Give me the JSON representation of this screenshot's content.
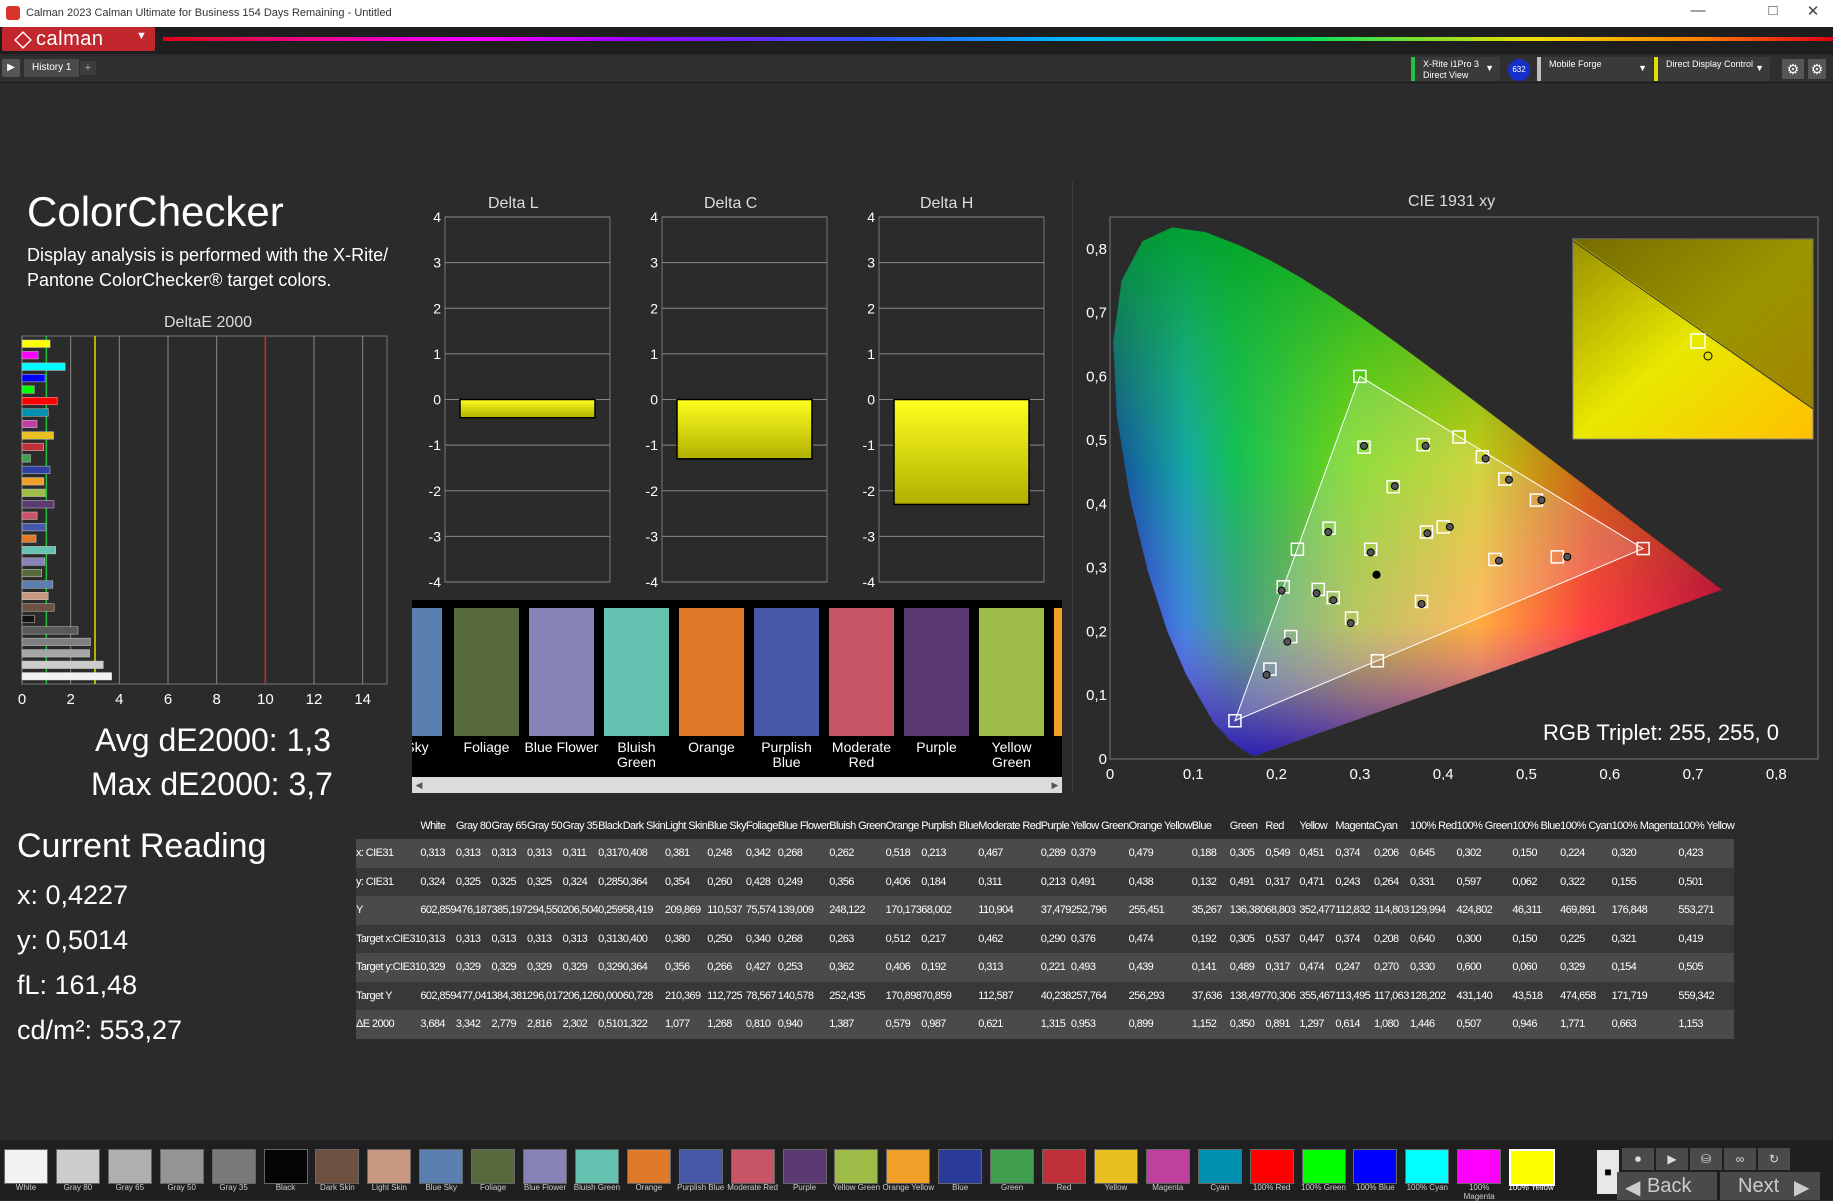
{
  "window": {
    "title": "Calman 2023 Calman Ultimate for Business 154 Days Remaining  -  Untitled",
    "minimize": "—",
    "maximize": "□",
    "close": "✕"
  },
  "logo": {
    "text": "calman",
    "menu": "▼"
  },
  "tabs": {
    "play": "▶",
    "active": "History 1",
    "add": "+"
  },
  "devices": [
    {
      "name": "X-Rite i1Pro 3\nDirect View",
      "color": "#22c040"
    },
    {
      "name": "Mobile Forge",
      "color": "#c0c0c0"
    },
    {
      "name": "Direct Display Control",
      "color": "#e0e000"
    }
  ],
  "device_badge": "632",
  "page": {
    "title": "ColorChecker",
    "description": "Display analysis is performed with the X-Rite/ Pantone ColorChecker® target colors.",
    "avg": "Avg dE2000: 1,3",
    "max": "Max dE2000: 3,7"
  },
  "current_reading": {
    "title": "Current Reading",
    "x": "x: 0,4227",
    "y": "y: 0,5014",
    "fl": "fL: 161,48",
    "cdm2": "cd/m²: 553,27"
  },
  "cie": {
    "title": "CIE 1931 xy",
    "rgb_triplet": "RGB Triplet: 255, 255, 0"
  },
  "swatch_strip": [
    {
      "label": "Sky",
      "color": "#5b7fb0"
    },
    {
      "label": "Foliage",
      "color": "#566a3e"
    },
    {
      "label": "Blue Flower",
      "color": "#8783b8"
    },
    {
      "label": "Bluish Green",
      "color": "#63c3b0"
    },
    {
      "label": "Orange",
      "color": "#e07a28"
    },
    {
      "label": "Purplish Blue",
      "color": "#4858a8"
    },
    {
      "label": "Moderate Red",
      "color": "#c85468"
    },
    {
      "label": "Purple",
      "color": "#5a3a70"
    },
    {
      "label": "Yellow Green",
      "color": "#a0bc48"
    }
  ],
  "chart_data": [
    {
      "type": "bar",
      "title": "DeltaE 2000",
      "orientation": "horizontal",
      "xlim": [
        0,
        15
      ],
      "xticks": [
        "0",
        "2",
        "4",
        "6",
        "8",
        "10",
        "12",
        "14"
      ],
      "reference_lines": [
        {
          "value": 1,
          "color": "#22c040"
        },
        {
          "value": 3,
          "color": "#e0e000"
        },
        {
          "value": 10,
          "color": "#e02020"
        }
      ],
      "categories": [
        "100% Yellow",
        "100% Magenta",
        "100% Cyan",
        "100% Blue",
        "100% Green",
        "100% Red",
        "Cyan",
        "Magenta",
        "Yellow",
        "Red",
        "Green",
        "Blue",
        "Orange Yellow",
        "Yellow Green",
        "Purple",
        "Moderate Red",
        "Purplish Blue",
        "Orange",
        "Bluish Green",
        "Blue Flower",
        "Foliage",
        "Blue Sky",
        "Light Skin",
        "Dark Skin",
        "Black",
        "Gray 35",
        "Gray 50",
        "Gray 65",
        "Gray 80",
        "White"
      ],
      "values": [
        1.153,
        0.663,
        1.771,
        0.946,
        0.507,
        1.446,
        1.08,
        0.614,
        1.297,
        0.891,
        0.35,
        1.152,
        0.899,
        0.953,
        1.315,
        0.621,
        0.987,
        0.579,
        1.387,
        0.94,
        0.81,
        1.268,
        1.077,
        1.322,
        0.51,
        2.302,
        2.816,
        2.779,
        3.342,
        3.684
      ],
      "colors": [
        "#ffff00",
        "#ff00ff",
        "#00ffff",
        "#0000ff",
        "#00ff00",
        "#ff0000",
        "#0090b0",
        "#c040a0",
        "#e8c020",
        "#c03038",
        "#40a050",
        "#3040a0",
        "#f0a028",
        "#a0bc48",
        "#5a3a70",
        "#c85468",
        "#4858a8",
        "#e07a28",
        "#63c3b0",
        "#8783b8",
        "#566a3e",
        "#5b7fb0",
        "#c89880",
        "#6e5040",
        "#111111",
        "#5a5a5a",
        "#7f7f7f",
        "#a6a6a6",
        "#cccccc",
        "#f2f2f2"
      ]
    },
    {
      "type": "bar",
      "title": "Delta L",
      "ylim": [
        -4,
        4
      ],
      "yticks": [
        "4",
        "3",
        "2",
        "1",
        "0",
        "-1",
        "-2",
        "-3",
        "-4"
      ],
      "values": [
        -0.4
      ],
      "color": "#f0f000"
    },
    {
      "type": "bar",
      "title": "Delta C",
      "ylim": [
        -4,
        4
      ],
      "yticks": [
        "4",
        "3",
        "2",
        "1",
        "0",
        "-1",
        "-2",
        "-3",
        "-4"
      ],
      "values": [
        -1.3
      ],
      "color": "#f0f000"
    },
    {
      "type": "bar",
      "title": "Delta H",
      "ylim": [
        -4,
        4
      ],
      "yticks": [
        "4",
        "3",
        "2",
        "1",
        "0",
        "-1",
        "-2",
        "-3",
        "-4"
      ],
      "values": [
        -2.3
      ],
      "color": "#f0f000"
    },
    {
      "type": "scatter",
      "title": "CIE 1931 xy",
      "xlim": [
        0,
        0.85
      ],
      "ylim": [
        0,
        0.85
      ],
      "xticks": [
        "0",
        "0,1",
        "0,2",
        "0,3",
        "0,4",
        "0,5",
        "0,6",
        "0,7",
        "0,8"
      ],
      "yticks": [
        "0,8",
        "0,7",
        "0,6",
        "0,5",
        "0,4",
        "0,3",
        "0,2",
        "0,1",
        "0"
      ],
      "gamut_triangle": [
        [
          0.64,
          0.33
        ],
        [
          0.3,
          0.6
        ],
        [
          0.15,
          0.06
        ]
      ],
      "targets": [
        [
          0.313,
          0.329
        ],
        [
          0.4,
          0.364
        ],
        [
          0.38,
          0.356
        ],
        [
          0.25,
          0.266
        ],
        [
          0.34,
          0.427
        ],
        [
          0.268,
          0.253
        ],
        [
          0.263,
          0.362
        ],
        [
          0.512,
          0.406
        ],
        [
          0.217,
          0.192
        ],
        [
          0.462,
          0.313
        ],
        [
          0.29,
          0.221
        ],
        [
          0.376,
          0.493
        ],
        [
          0.474,
          0.439
        ],
        [
          0.192,
          0.141
        ],
        [
          0.305,
          0.489
        ],
        [
          0.537,
          0.317
        ],
        [
          0.447,
          0.474
        ],
        [
          0.374,
          0.247
        ],
        [
          0.208,
          0.27
        ],
        [
          0.64,
          0.33
        ],
        [
          0.3,
          0.6
        ],
        [
          0.15,
          0.06
        ],
        [
          0.225,
          0.329
        ],
        [
          0.321,
          0.154
        ],
        [
          0.419,
          0.505
        ]
      ],
      "measured": [
        [
          0.313,
          0.324
        ],
        [
          0.408,
          0.364
        ],
        [
          0.381,
          0.354
        ],
        [
          0.248,
          0.26
        ],
        [
          0.342,
          0.428
        ],
        [
          0.268,
          0.249
        ],
        [
          0.262,
          0.356
        ],
        [
          0.518,
          0.406
        ],
        [
          0.213,
          0.184
        ],
        [
          0.467,
          0.311
        ],
        [
          0.289,
          0.213
        ],
        [
          0.379,
          0.491
        ],
        [
          0.479,
          0.438
        ],
        [
          0.188,
          0.132
        ],
        [
          0.305,
          0.491
        ],
        [
          0.549,
          0.317
        ],
        [
          0.451,
          0.471
        ],
        [
          0.374,
          0.243
        ],
        [
          0.206,
          0.264
        ],
        [
          0.32,
          0.289
        ]
      ],
      "current_reading": [
        0.4227,
        0.5014
      ]
    }
  ],
  "table": {
    "columns": [
      "",
      "White",
      "Gray 80",
      "Gray 65",
      "Gray 50",
      "Gray 35",
      "Black",
      "Dark Skin",
      "Light Skin",
      "Blue Sky",
      "Foliage",
      "Blue Flower",
      "Bluish Green",
      "Orange",
      "Purplish Blue",
      "Moderate Red",
      "Purple",
      "Yellow Green",
      "Orange Yellow",
      "Blue",
      "Green",
      "Red",
      "Yellow",
      "Magenta",
      "Cyan",
      "100% Red",
      "100% Green",
      "100% Blue",
      "100% Cyan",
      "100% Magenta",
      "100% Yellow"
    ],
    "rows": [
      [
        "x: CIE31",
        "0,313",
        "0,313",
        "0,313",
        "0,313",
        "0,311",
        "0,317",
        "0,408",
        "0,381",
        "0,248",
        "0,342",
        "0,268",
        "0,262",
        "0,518",
        "0,213",
        "0,467",
        "0,289",
        "0,379",
        "0,479",
        "0,188",
        "0,305",
        "0,549",
        "0,451",
        "0,374",
        "0,206",
        "0,645",
        "0,302",
        "0,150",
        "0,224",
        "0,320",
        "0,423"
      ],
      [
        "y: CIE31",
        "0,324",
        "0,325",
        "0,325",
        "0,325",
        "0,324",
        "0,285",
        "0,364",
        "0,354",
        "0,260",
        "0,428",
        "0,249",
        "0,356",
        "0,406",
        "0,184",
        "0,311",
        "0,213",
        "0,491",
        "0,438",
        "0,132",
        "0,491",
        "0,317",
        "0,471",
        "0,243",
        "0,264",
        "0,331",
        "0,597",
        "0,062",
        "0,322",
        "0,155",
        "0,501"
      ],
      [
        "Y",
        "602,859",
        "476,187",
        "385,197",
        "294,550",
        "206,504",
        "0,259",
        "58,419",
        "209,869",
        "110,537",
        "75,574",
        "139,009",
        "248,122",
        "170,173",
        "68,002",
        "110,904",
        "37,479",
        "252,796",
        "255,451",
        "35,267",
        "136,380",
        "68,803",
        "352,477",
        "112,832",
        "114,803",
        "129,994",
        "424,802",
        "46,311",
        "469,891",
        "176,848",
        "553,271"
      ],
      [
        "Target x:CIE31",
        "0,313",
        "0,313",
        "0,313",
        "0,313",
        "0,313",
        "0,313",
        "0,400",
        "0,380",
        "0,250",
        "0,340",
        "0,268",
        "0,263",
        "0,512",
        "0,217",
        "0,462",
        "0,290",
        "0,376",
        "0,474",
        "0,192",
        "0,305",
        "0,537",
        "0,447",
        "0,374",
        "0,208",
        "0,640",
        "0,300",
        "0,150",
        "0,225",
        "0,321",
        "0,419"
      ],
      [
        "Target y:CIE31",
        "0,329",
        "0,329",
        "0,329",
        "0,329",
        "0,329",
        "0,329",
        "0,364",
        "0,356",
        "0,266",
        "0,427",
        "0,253",
        "0,362",
        "0,406",
        "0,192",
        "0,313",
        "0,221",
        "0,493",
        "0,439",
        "0,141",
        "0,489",
        "0,317",
        "0,474",
        "0,247",
        "0,270",
        "0,330",
        "0,600",
        "0,060",
        "0,329",
        "0,154",
        "0,505"
      ],
      [
        "Target Y",
        "602,859",
        "477,041",
        "384,381",
        "296,017",
        "206,126",
        "0,000",
        "60,728",
        "210,369",
        "112,725",
        "78,567",
        "140,578",
        "252,435",
        "170,898",
        "70,859",
        "112,587",
        "40,238",
        "257,764",
        "256,293",
        "37,636",
        "138,497",
        "70,306",
        "355,467",
        "113,495",
        "117,063",
        "128,202",
        "431,140",
        "43,518",
        "474,658",
        "171,719",
        "559,342"
      ],
      [
        "ΔE 2000",
        "3,684",
        "3,342",
        "2,779",
        "2,816",
        "2,302",
        "0,510",
        "1,322",
        "1,077",
        "1,268",
        "0,810",
        "0,940",
        "1,387",
        "0,579",
        "0,987",
        "0,621",
        "1,315",
        "0,953",
        "0,899",
        "1,152",
        "0,350",
        "0,891",
        "1,297",
        "0,614",
        "1,080",
        "1,446",
        "0,507",
        "0,946",
        "1,771",
        "0,663",
        "1,153"
      ]
    ]
  },
  "bottom_swatches": [
    {
      "label": "White",
      "color": "#f2f2f2"
    },
    {
      "label": "Gray 80",
      "color": "#cccccc"
    },
    {
      "label": "Gray 65",
      "color": "#b0b0b0"
    },
    {
      "label": "Gray 50",
      "color": "#959595"
    },
    {
      "label": "Gray 35",
      "color": "#7a7a7a"
    },
    {
      "label": "Black",
      "color": "#050505"
    },
    {
      "label": "Dark Skin",
      "color": "#6e5040"
    },
    {
      "label": "Light Skin",
      "color": "#c89880"
    },
    {
      "label": "Blue Sky",
      "color": "#5b7fb0"
    },
    {
      "label": "Foliage",
      "color": "#566a3e"
    },
    {
      "label": "Blue Flower",
      "color": "#8783b8"
    },
    {
      "label": "Bluish Green",
      "color": "#63c3b0"
    },
    {
      "label": "Orange",
      "color": "#e07a28"
    },
    {
      "label": "Purplish Blue",
      "color": "#4858a8"
    },
    {
      "label": "Moderate Red",
      "color": "#c85468"
    },
    {
      "label": "Purple",
      "color": "#5a3a70"
    },
    {
      "label": "Yellow Green",
      "color": "#a0bc48"
    },
    {
      "label": "Orange Yellow",
      "color": "#f0a028"
    },
    {
      "label": "Blue",
      "color": "#2a3a9a"
    },
    {
      "label": "Green",
      "color": "#40a050"
    },
    {
      "label": "Red",
      "color": "#c03038"
    },
    {
      "label": "Yellow",
      "color": "#e8c020"
    },
    {
      "label": "Magenta",
      "color": "#c040a0"
    },
    {
      "label": "Cyan",
      "color": "#0090b0"
    },
    {
      "label": "100% Red",
      "color": "#ff0000"
    },
    {
      "label": "100% Green",
      "color": "#00ff00"
    },
    {
      "label": "100% Blue",
      "color": "#0000ff"
    },
    {
      "label": "100% Cyan",
      "color": "#00ffff"
    },
    {
      "label": "100% Magenta",
      "color": "#ff00ff"
    },
    {
      "label": "100% Yellow",
      "color": "#ffff00"
    }
  ],
  "nav": {
    "back": "Back",
    "next": "Next",
    "stop": "■",
    "play": "▶",
    "save": "⛁",
    "link": "∞",
    "refresh": "↻"
  }
}
